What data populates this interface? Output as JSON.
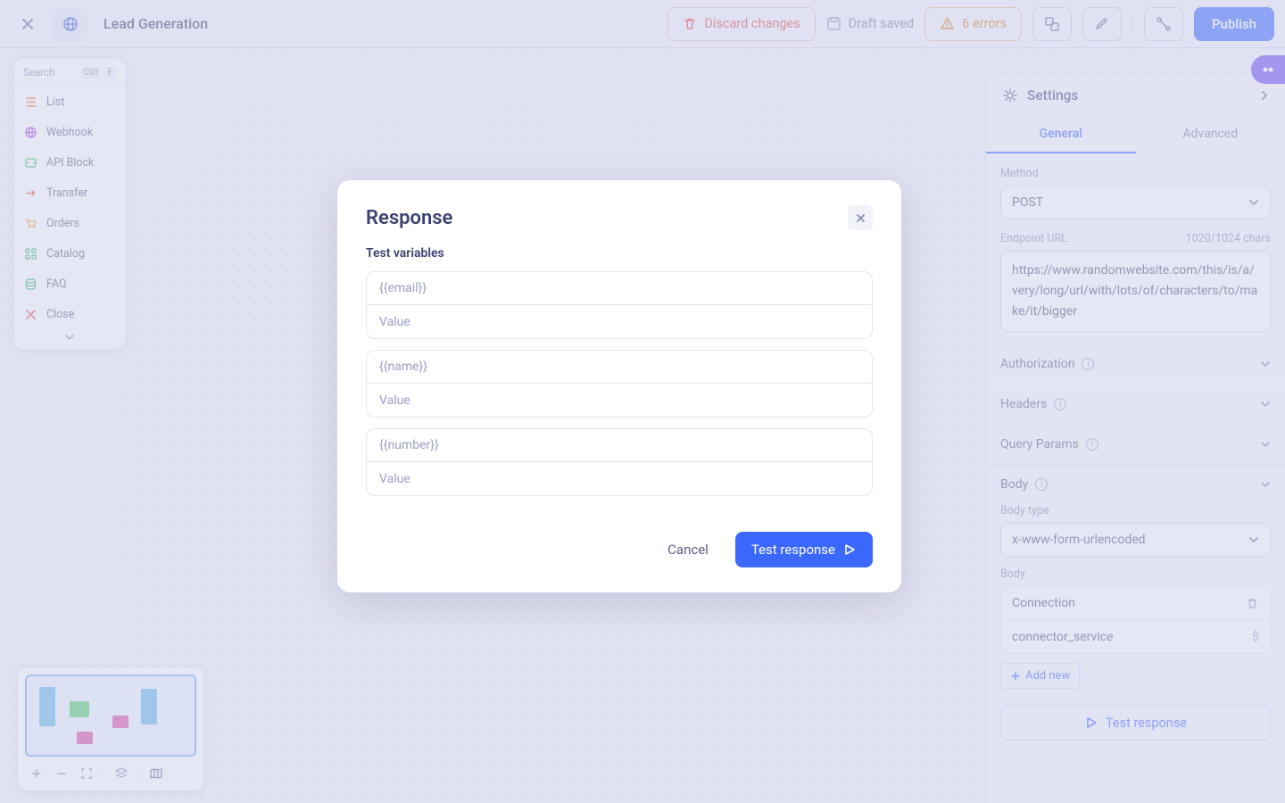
{
  "header": {
    "title": "Lead Generation",
    "discard": "Discard changes",
    "draft": "Draft saved",
    "errors": "6 errors",
    "publish": "Publish"
  },
  "palette": {
    "search": "Search",
    "kbd1": "Ctrl",
    "kbd2": "F",
    "items": [
      {
        "label": "List"
      },
      {
        "label": "Webhook"
      },
      {
        "label": "API Block"
      },
      {
        "label": "Transfer"
      },
      {
        "label": "Orders"
      },
      {
        "label": "Catalog"
      },
      {
        "label": "FAQ"
      },
      {
        "label": "Close"
      }
    ]
  },
  "settings": {
    "title": "Settings",
    "tabs": {
      "general": "General",
      "advanced": "Advanced"
    },
    "method_label": "Method",
    "method": "POST",
    "url_label": "Endpoint URL",
    "url_count": "1020/1024 chars",
    "url": "https://www.randomwebsite.com/this/is/a/very/long/url/with/lots/of/characters/to/make/it/bigger",
    "authorization": "Authorization",
    "headers": "Headers",
    "query": "Query Params",
    "body": "Body",
    "body_type_label": "Body type",
    "body_type": "x-www-form-urlencoded",
    "body_label": "Body",
    "body_key": "Connection",
    "body_val": "connector_service",
    "dollar": "$",
    "add_new": "Add new",
    "test": "Test response"
  },
  "modal": {
    "title": "Response",
    "sub": "Test variables",
    "vars": [
      {
        "name": "{{email}}",
        "ph": "Value"
      },
      {
        "name": "{{name}}",
        "ph": "Value"
      },
      {
        "name": "{{number}}",
        "ph": "Value"
      }
    ],
    "cancel": "Cancel",
    "test": "Test response"
  }
}
